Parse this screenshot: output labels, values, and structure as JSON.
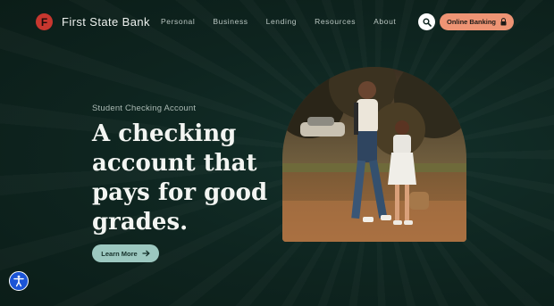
{
  "brand": {
    "name": "First State Bank",
    "logo_letter": "F",
    "logo_color": "#c8372f"
  },
  "nav": {
    "items": [
      {
        "label": "Personal"
      },
      {
        "label": "Business"
      },
      {
        "label": "Lending"
      },
      {
        "label": "Resources"
      },
      {
        "label": "About"
      }
    ]
  },
  "header": {
    "search_icon": "search-icon",
    "online_banking_label": "Online Banking",
    "online_banking_icon": "lock-icon",
    "online_banking_color": "#ee9474"
  },
  "hero": {
    "eyebrow": "Student Checking Account",
    "headline": "A checking account that pays for good grades.",
    "cta_label": "Learn More",
    "cta_icon": "arrow-right-icon",
    "cta_color": "#9cc8c0",
    "image_icon": "photo-father-daughter-walking"
  },
  "accessibility": {
    "icon": "accessibility-icon",
    "color": "#1b54d6"
  },
  "colors": {
    "background": "#0d211c",
    "headline": "#f3f5f2"
  }
}
